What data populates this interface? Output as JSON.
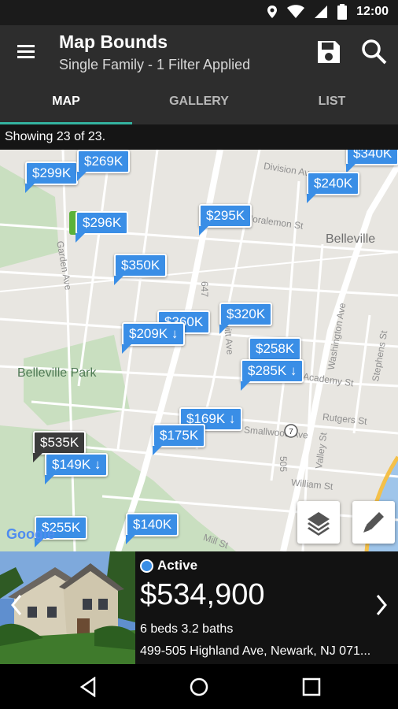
{
  "status_bar": {
    "time": "12:00",
    "icons": [
      "location-icon",
      "wifi-icon",
      "signal-icon",
      "battery-icon"
    ]
  },
  "app_bar": {
    "title": "Map Bounds",
    "subtitle": "Single Family - 1 Filter Applied",
    "icons": [
      "menu-icon",
      "save-icon",
      "search-icon"
    ]
  },
  "tabs": [
    {
      "label": "MAP",
      "active": true
    },
    {
      "label": "GALLERY"
    },
    {
      "label": "LIST"
    }
  ],
  "showing_text": "Showing 23 of 23.",
  "map": {
    "streets": [
      "Division Av",
      "Garden Ave",
      "Joralemon St",
      "Dewitt Ave",
      "Washington Ave",
      "Academy St",
      "Rutgers St",
      "Stephens St",
      "Valley St",
      "William St",
      "Mill St",
      "Smallwood Ave"
    ],
    "places": [
      "Belleville",
      "Belleville Park"
    ],
    "route_shield": "7",
    "vertical_labels": [
      "505",
      "647"
    ],
    "attribution": "Google",
    "pins": [
      {
        "label": "$299K"
      },
      {
        "label": "$269K"
      },
      {
        "label": "$340K"
      },
      {
        "label": "$240K"
      },
      {
        "label": "$296K"
      },
      {
        "label": "$295K"
      },
      {
        "label": "$350K"
      },
      {
        "label": "$360K"
      },
      {
        "label": "$209K"
      },
      {
        "label": "$320K"
      },
      {
        "label": "$258K"
      },
      {
        "label": "$285K"
      },
      {
        "label": "$169K"
      },
      {
        "label": "$175K"
      },
      {
        "label": "$535K"
      },
      {
        "label": "$149K"
      },
      {
        "label": "$255K"
      },
      {
        "label": "$140K"
      }
    ]
  },
  "listing": {
    "status": "Active",
    "price": "$534,900",
    "beds_baths": "6 beds 3.2 baths",
    "address": "499-505 Highland Ave, Newark, NJ 071..."
  },
  "colors": {
    "accent": "#3a8ee6",
    "tab_indicator": "#34b3a0",
    "appbar": "#2d2d2d",
    "map_bg": "#e8e6e1",
    "park": "#c9dfc0"
  }
}
